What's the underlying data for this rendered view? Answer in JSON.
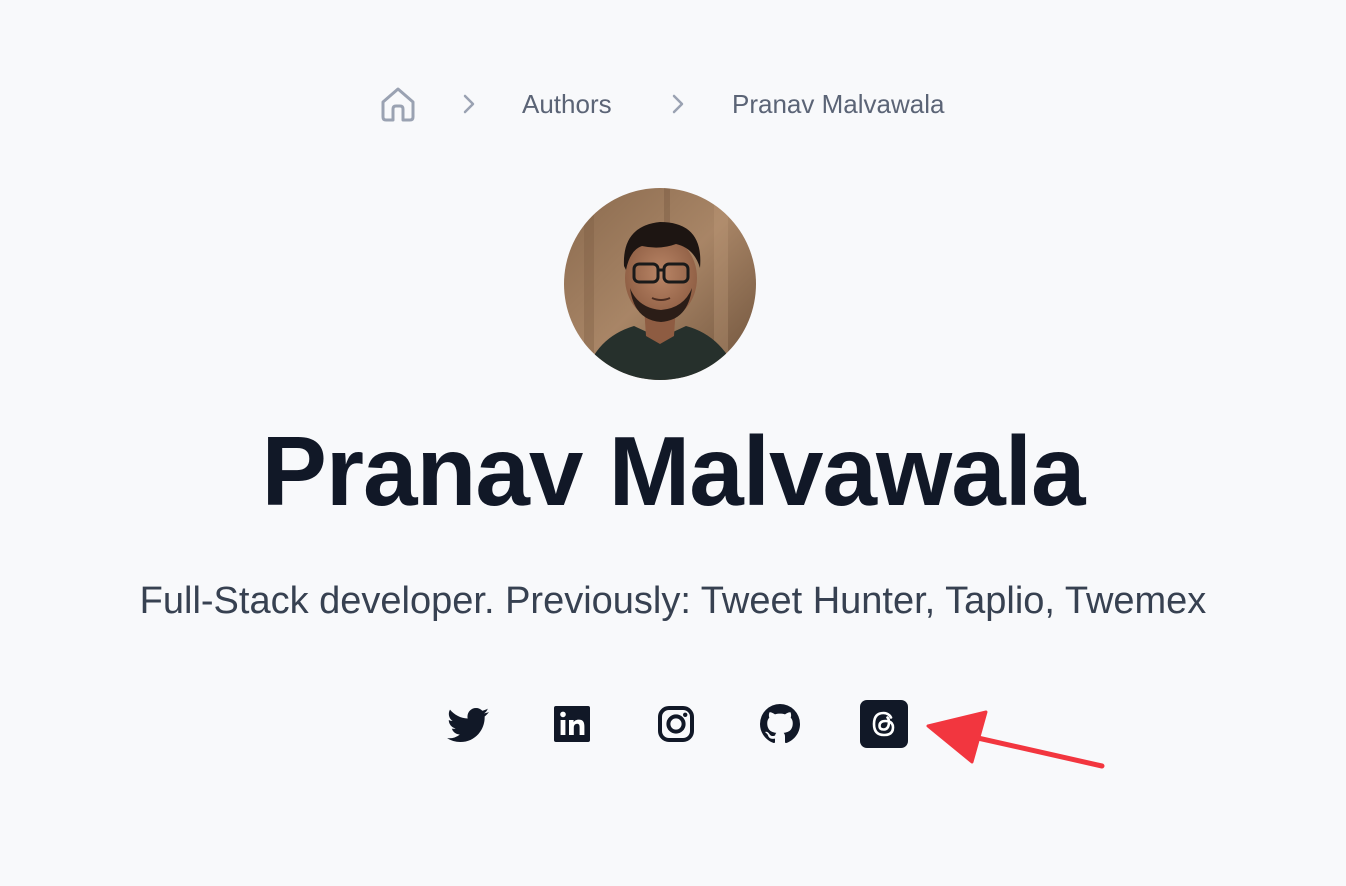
{
  "breadcrumb": {
    "home_icon": "home-icon",
    "separator_icon": "chevron-right-icon",
    "items": [
      {
        "label": "Authors"
      },
      {
        "label": "Pranav Malvawala"
      }
    ]
  },
  "author": {
    "name": "Pranav Malvawala",
    "bio": "Full-Stack developer. Previously: Tweet Hunter, Taplio, Twemex",
    "avatar_alt": "Pranav Malvawala"
  },
  "social": [
    {
      "network": "Twitter",
      "icon": "twitter-icon"
    },
    {
      "network": "LinkedIn",
      "icon": "linkedin-icon"
    },
    {
      "network": "Instagram",
      "icon": "instagram-icon"
    },
    {
      "network": "GitHub",
      "icon": "github-icon"
    },
    {
      "network": "Threads",
      "icon": "threads-icon"
    }
  ],
  "annotation": {
    "icon": "red-arrow-icon",
    "color": "#f2363f"
  },
  "colors": {
    "background": "#f8f9fb",
    "heading": "#111827",
    "body_text": "#374151",
    "muted": "#5b6476",
    "icon_dark": "#111827"
  }
}
